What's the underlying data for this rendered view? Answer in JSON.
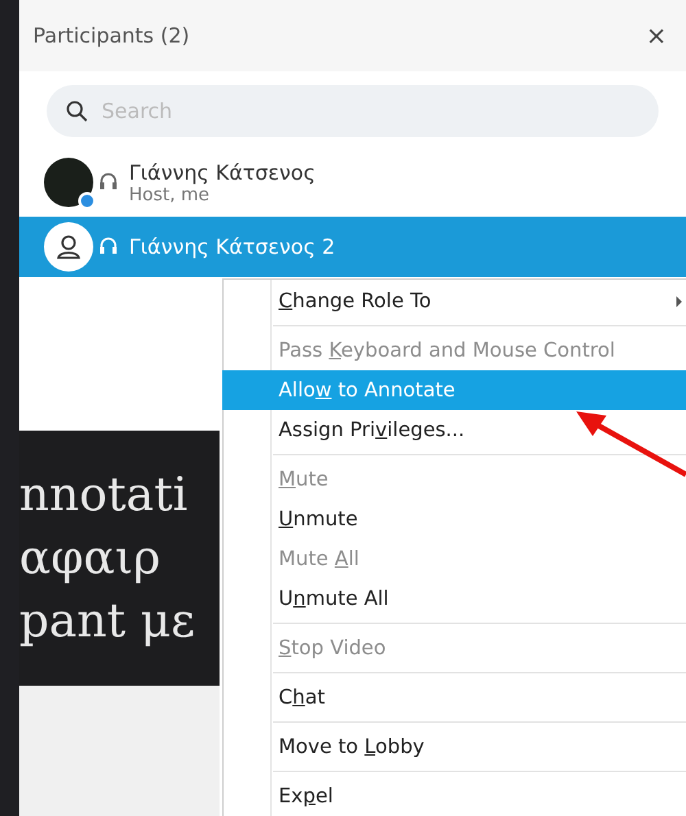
{
  "panel": {
    "title": "Participants (2)",
    "close": "×"
  },
  "search": {
    "placeholder": "Search"
  },
  "participants": [
    {
      "name": "Γιάννης Κάτσενος",
      "role": "Host, me",
      "kind": "photo",
      "selected": false
    },
    {
      "name": "Γιάννης Κάτσενος 2",
      "kind": "generic",
      "selected": true
    }
  ],
  "slide": {
    "lines": [
      "nnotati",
      "αφαιρ",
      "pant με"
    ]
  },
  "context_menu": {
    "items": [
      {
        "kind": "item",
        "key": "C",
        "post": "hange Role To",
        "disabled": false,
        "selected": false,
        "submenu": true
      },
      {
        "kind": "separator"
      },
      {
        "kind": "item",
        "pre": "Pass ",
        "key": "K",
        "post": "eyboard and Mouse Control",
        "disabled": true,
        "selected": false,
        "submenu": false
      },
      {
        "kind": "item",
        "pre": "Allo",
        "key": "w",
        "post": " to Annotate",
        "disabled": false,
        "selected": true,
        "submenu": false
      },
      {
        "kind": "item",
        "pre": "Assign Pri",
        "key": "v",
        "post": "ileges...",
        "disabled": false,
        "selected": false,
        "submenu": false
      },
      {
        "kind": "separator"
      },
      {
        "kind": "item",
        "key": "M",
        "post": "ute",
        "disabled": true,
        "selected": false,
        "submenu": false
      },
      {
        "kind": "item",
        "key": "U",
        "post": "nmute",
        "disabled": false,
        "selected": false,
        "submenu": false
      },
      {
        "kind": "item",
        "pre": "Mute ",
        "key": "A",
        "post": "ll",
        "disabled": true,
        "selected": false,
        "submenu": false
      },
      {
        "kind": "item",
        "pre": "U",
        "key": "n",
        "post": "mute All",
        "disabled": false,
        "selected": false,
        "submenu": false
      },
      {
        "kind": "separator"
      },
      {
        "kind": "item",
        "key": "S",
        "post": "top Video",
        "disabled": true,
        "selected": false,
        "submenu": false
      },
      {
        "kind": "separator"
      },
      {
        "kind": "item",
        "pre": "C",
        "key": "h",
        "post": "at",
        "disabled": false,
        "selected": false,
        "submenu": false
      },
      {
        "kind": "separator"
      },
      {
        "kind": "item",
        "pre": "Move to ",
        "key": "L",
        "post": "obby",
        "disabled": false,
        "selected": false,
        "submenu": false
      },
      {
        "kind": "separator"
      },
      {
        "kind": "item",
        "pre": "Ex",
        "key": "p",
        "post": "el",
        "disabled": false,
        "selected": false,
        "submenu": false
      }
    ]
  }
}
